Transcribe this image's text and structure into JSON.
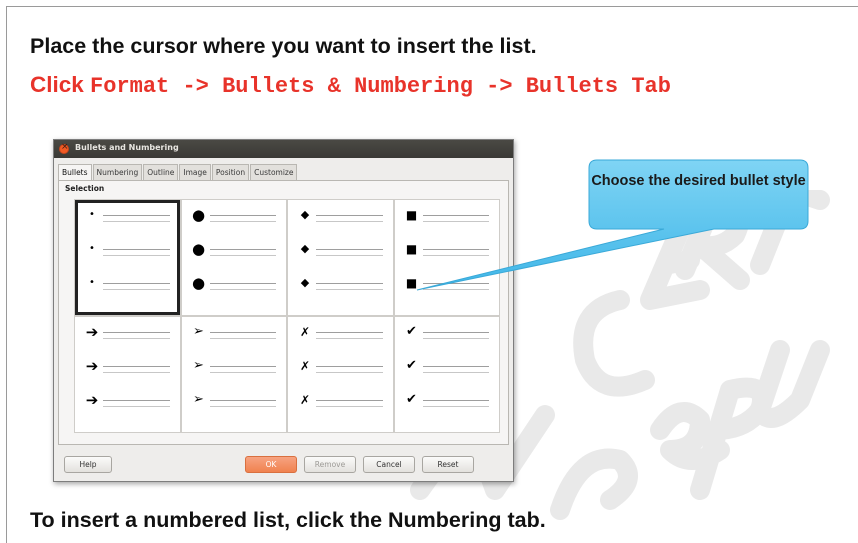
{
  "instructions": {
    "line1": "Place the cursor where you want to insert the list.",
    "line2_click": "Click",
    "line2_path": "Format -> Bullets & Numbering -> Bullets Tab",
    "line3": "To insert a numbered list, click the Numbering tab."
  },
  "callout": {
    "text": "Choose the desired bullet style",
    "color": "#55c4ee"
  },
  "dialog": {
    "title": "Bullets and Numbering",
    "tabs": [
      "Bullets",
      "Numbering",
      "Outline",
      "Image",
      "Position",
      "Customize"
    ],
    "active_tab": "Bullets",
    "selection_label": "Selection",
    "bullet_styles": [
      {
        "icon": "small-dot-bullet-icon",
        "glyph": "•",
        "cls": "b-dot",
        "selected": true
      },
      {
        "icon": "large-dot-bullet-icon",
        "glyph": "●",
        "cls": "b-circle",
        "selected": false
      },
      {
        "icon": "diamond-bullet-icon",
        "glyph": "◆",
        "cls": "b-diamond",
        "selected": false
      },
      {
        "icon": "square-bullet-icon",
        "glyph": "■",
        "cls": "b-square",
        "selected": false
      },
      {
        "icon": "arrow-bullet-icon",
        "glyph": "➔",
        "cls": "b-arrow",
        "selected": false
      },
      {
        "icon": "arrowhead-bullet-icon",
        "glyph": "➢",
        "cls": "b-arrowhead",
        "selected": false
      },
      {
        "icon": "cross-bullet-icon",
        "glyph": "✗",
        "cls": "b-x",
        "selected": false
      },
      {
        "icon": "checkmark-bullet-icon",
        "glyph": "✔",
        "cls": "b-check",
        "selected": false
      }
    ],
    "buttons": {
      "help": "Help",
      "ok": "OK",
      "remove": "Remove",
      "cancel": "Cancel",
      "reset": "Reset"
    }
  },
  "colors": {
    "red_text": "#e8332a",
    "ok_button": "#f0824f"
  },
  "watermark_text": "NCERT"
}
